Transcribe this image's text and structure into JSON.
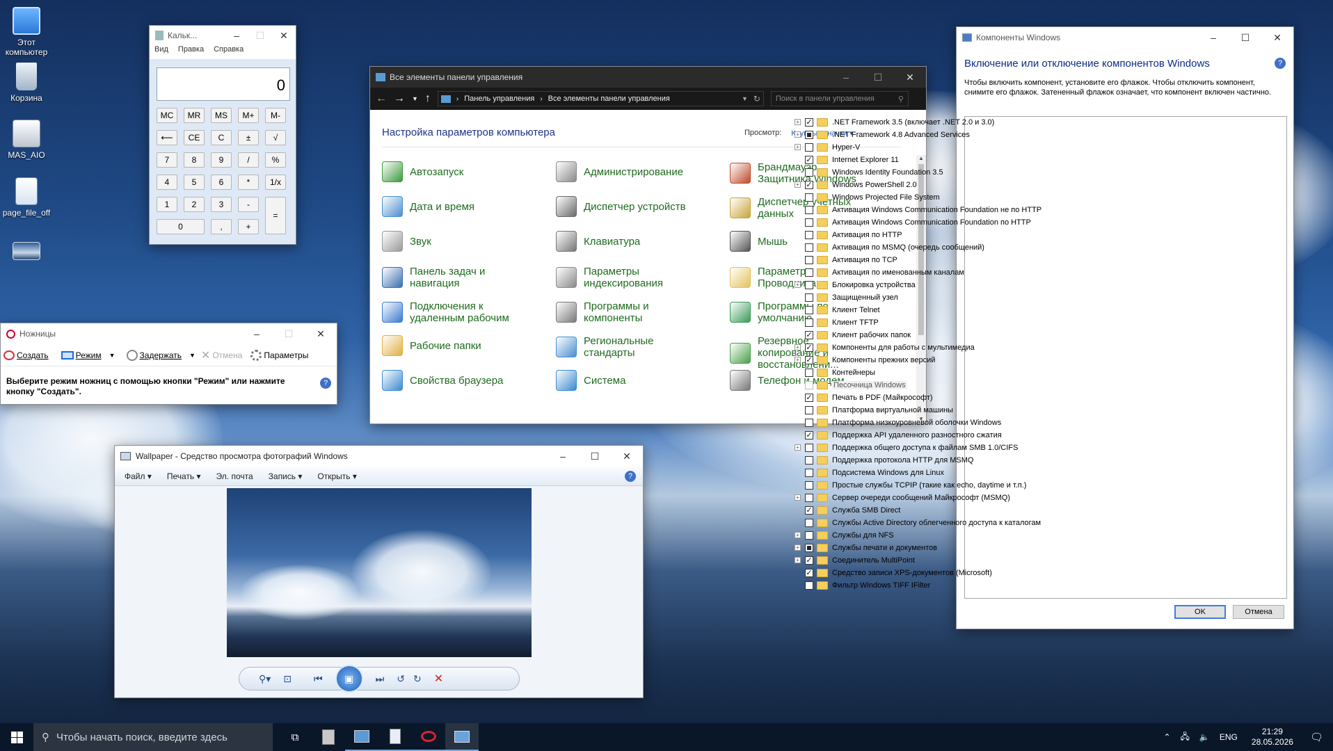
{
  "desktop": {
    "icons": [
      {
        "label": "Этот\nкомпьютер",
        "icon": "computer-icon"
      },
      {
        "label": "Корзина",
        "icon": "recycle-bin-icon"
      },
      {
        "label": "MAS_AIO",
        "icon": "script-icon"
      },
      {
        "label": "page_file_off",
        "icon": "file-icon"
      }
    ]
  },
  "calculator": {
    "title": "Кальк...",
    "menu": [
      "Вид",
      "Правка",
      "Справка"
    ],
    "display": "0",
    "rows": [
      [
        "MC",
        "MR",
        "MS",
        "M+",
        "M-"
      ],
      [
        "⟵",
        "CE",
        "C",
        "±",
        "√"
      ],
      [
        "7",
        "8",
        "9",
        "/",
        "%"
      ],
      [
        "4",
        "5",
        "6",
        "*",
        "1/x"
      ],
      [
        "1",
        "2",
        "3",
        "-",
        "="
      ],
      [
        "0",
        ",",
        "+"
      ]
    ]
  },
  "snipping": {
    "title": "Ножницы",
    "toolbar": [
      "Создать",
      "Режим",
      "Задержать",
      "Отмена",
      "Параметры"
    ],
    "message": "Выберите режим ножниц с помощью кнопки \"Режим\" или нажмите кнопку \"Создать\"."
  },
  "control_panel": {
    "title": "Все элементы панели управления",
    "breadcrumb": [
      "Панель управления",
      "Все элементы панели управления"
    ],
    "search_placeholder": "Поиск в панели управления",
    "heading": "Настройка параметров компьютера",
    "view_label": "Просмотр:",
    "view_value": "Крупные значки",
    "items": [
      {
        "label": "Автозапуск",
        "color": "#3c9a3c"
      },
      {
        "label": "Администрирование",
        "color": "#8a8a8a"
      },
      {
        "label": "Брандмауэр Защитника Windows",
        "color": "#c04a2a"
      },
      {
        "label": "Дата и время",
        "color": "#4a8fd0"
      },
      {
        "label": "Диспетчер устройств",
        "color": "#6a6a6a"
      },
      {
        "label": "Диспетчер учетных данных",
        "color": "#c9a43a"
      },
      {
        "label": "Звук",
        "color": "#9a9a9a"
      },
      {
        "label": "Клавиатура",
        "color": "#777777"
      },
      {
        "label": "Мышь",
        "color": "#555555"
      },
      {
        "label": "Панель задач и навигация",
        "color": "#3a6fb0"
      },
      {
        "label": "Параметры индексирования",
        "color": "#8a8a8a"
      },
      {
        "label": "Параметры Проводника",
        "color": "#e3c25a"
      },
      {
        "label": "Подключения к удаленным рабочим",
        "color": "#3a7ad0"
      },
      {
        "label": "Программы и компоненты",
        "color": "#7a7a7a"
      },
      {
        "label": "Программы по умолчанию",
        "color": "#3a9a5a"
      },
      {
        "label": "Рабочие папки",
        "color": "#e0b040"
      },
      {
        "label": "Региональные стандарты",
        "color": "#4a8fd0"
      },
      {
        "label": "Резервное копирование и восстановлени...",
        "color": "#4aa04a"
      },
      {
        "label": "Свойства браузера",
        "color": "#3a8ad0"
      },
      {
        "label": "Система",
        "color": "#3a8ad0"
      },
      {
        "label": "Телефон и модем",
        "color": "#777777"
      }
    ]
  },
  "photo_viewer": {
    "title": "Wallpaper - Средство просмотра фотографий Windows",
    "menu": [
      "Файл",
      "Печать",
      "Эл. почта",
      "Запись",
      "Открыть"
    ]
  },
  "features": {
    "title": "Компоненты Windows",
    "heading": "Включение или отключение компонентов Windows",
    "description": "Чтобы включить компонент, установите его флажок. Чтобы отключить компонент, снимите его флажок. Затененный флажок означает, что компонент включен частично.",
    "items": [
      {
        "label": ".NET Framework 3.5 (включает .NET 2.0 и 3.0)",
        "expand": true,
        "state": "checked"
      },
      {
        "label": ".NET Framework 4.8 Advanced Services",
        "expand": true,
        "state": "partial"
      },
      {
        "label": "Hyper-V",
        "expand": true,
        "state": "unchecked"
      },
      {
        "label": "Internet Explorer 11",
        "expand": false,
        "state": "checked"
      },
      {
        "label": "Windows Identity Foundation 3.5",
        "expand": false,
        "state": "unchecked"
      },
      {
        "label": "Windows PowerShell 2.0",
        "expand": true,
        "state": "checked"
      },
      {
        "label": "Windows Projected File System",
        "expand": false,
        "state": "unchecked"
      },
      {
        "label": "Активация Windows Communication Foundation не по HTTP",
        "expand": false,
        "state": "unchecked"
      },
      {
        "label": "Активация Windows Communication Foundation по HTTP",
        "expand": false,
        "state": "unchecked"
      },
      {
        "label": "Активация по HTTP",
        "expand": false,
        "state": "unchecked"
      },
      {
        "label": "Активация по MSMQ (очередь сообщений)",
        "expand": false,
        "state": "unchecked"
      },
      {
        "label": "Активация по TCP",
        "expand": false,
        "state": "unchecked"
      },
      {
        "label": "Активация по именованным каналам",
        "expand": false,
        "state": "unchecked"
      },
      {
        "label": "Блокировка устройства",
        "expand": true,
        "state": "unchecked"
      },
      {
        "label": "Защищенный узел",
        "expand": false,
        "state": "unchecked"
      },
      {
        "label": "Клиент Telnet",
        "expand": false,
        "state": "unchecked"
      },
      {
        "label": "Клиент TFTP",
        "expand": false,
        "state": "unchecked"
      },
      {
        "label": "Клиент рабочих папок",
        "expand": false,
        "state": "checked"
      },
      {
        "label": "Компоненты для работы с мультимедиа",
        "expand": true,
        "state": "checked"
      },
      {
        "label": "Компоненты прежних версий",
        "expand": true,
        "state": "checked"
      },
      {
        "label": "Контейнеры",
        "expand": false,
        "state": "unchecked"
      },
      {
        "label": "Песочница Windows",
        "expand": false,
        "state": "disabled"
      },
      {
        "label": "Печать в PDF (Майкрософт)",
        "expand": false,
        "state": "checked"
      },
      {
        "label": "Платформа виртуальной машины",
        "expand": false,
        "state": "unchecked"
      },
      {
        "label": "Платформа низкоуровневой оболочки Windows",
        "expand": false,
        "state": "unchecked"
      },
      {
        "label": "Поддержка API удаленного разностного сжатия",
        "expand": false,
        "state": "checked"
      },
      {
        "label": "Поддержка общего доступа к файлам SMB 1.0/CIFS",
        "expand": true,
        "state": "unchecked"
      },
      {
        "label": "Поддержка протокола HTTP для MSMQ",
        "expand": false,
        "state": "unchecked"
      },
      {
        "label": "Подсистема Windows для Linux",
        "expand": false,
        "state": "unchecked"
      },
      {
        "label": "Простые службы TCPIP (такие как echo, daytime и т.п.)",
        "expand": false,
        "state": "unchecked"
      },
      {
        "label": "Сервер очереди сообщений Майкрософт (MSMQ)",
        "expand": true,
        "state": "unchecked"
      },
      {
        "label": "Служба SMB Direct",
        "expand": false,
        "state": "checked"
      },
      {
        "label": "Службы Active Directory облегченного доступа к каталогам",
        "expand": false,
        "state": "unchecked"
      },
      {
        "label": "Службы для NFS",
        "expand": true,
        "state": "unchecked"
      },
      {
        "label": "Службы печати и документов",
        "expand": true,
        "state": "partial"
      },
      {
        "label": "Соединитель MultiPoint",
        "expand": true,
        "state": "checked"
      },
      {
        "label": "Средство записи XPS-документов (Microsoft)",
        "expand": false,
        "state": "checked"
      },
      {
        "label": "Фильтр Windows TIFF IFilter",
        "expand": false,
        "state": "unchecked"
      }
    ],
    "ok": "OK",
    "cancel": "Отмена"
  },
  "taskbar": {
    "search_placeholder": "Чтобы начать поиск, введите здесь",
    "language": "ENG",
    "time": "21:29",
    "date": "28.05.2026"
  }
}
